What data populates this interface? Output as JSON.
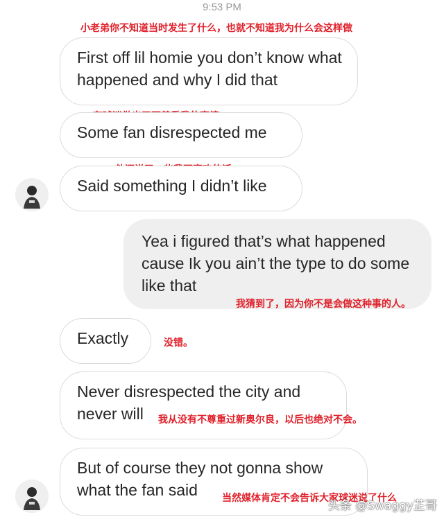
{
  "status": {
    "time": "9:53 PM"
  },
  "messages": [
    {
      "text": "First off lil homie you don’t know what happened and why I did that",
      "annotation": "小老弟你不知道当时发生了什么，也就不知道我为什么会这样做"
    },
    {
      "text": "Some fan disrespected me",
      "annotation": "有球迷做出了不尊重我的事情"
    },
    {
      "text": "Said something I didn’t like",
      "annotation": "他还说了一些我不喜欢的话"
    },
    {
      "text": "Yea i figured that’s what happened cause Ik you ain’t the type to do some like that",
      "annotation": "我猜到了，因为你不是会做这种事的人。"
    },
    {
      "text": "Exactly",
      "annotation": "没错。"
    },
    {
      "text": "Never disrespected the city and never will",
      "annotation": "我从没有不尊重过新奥尔良，以后也绝对不会。"
    },
    {
      "text": "But of course they not gonna show what the fan said",
      "annotation": "当然媒体肯定不会告诉大家球迷说了什么"
    }
  ],
  "watermark": "头条 @Swaggy芷哥",
  "colors": {
    "annotation": "#e0202a",
    "received_border": "#dbdbdb",
    "sent_background": "#efefef"
  }
}
